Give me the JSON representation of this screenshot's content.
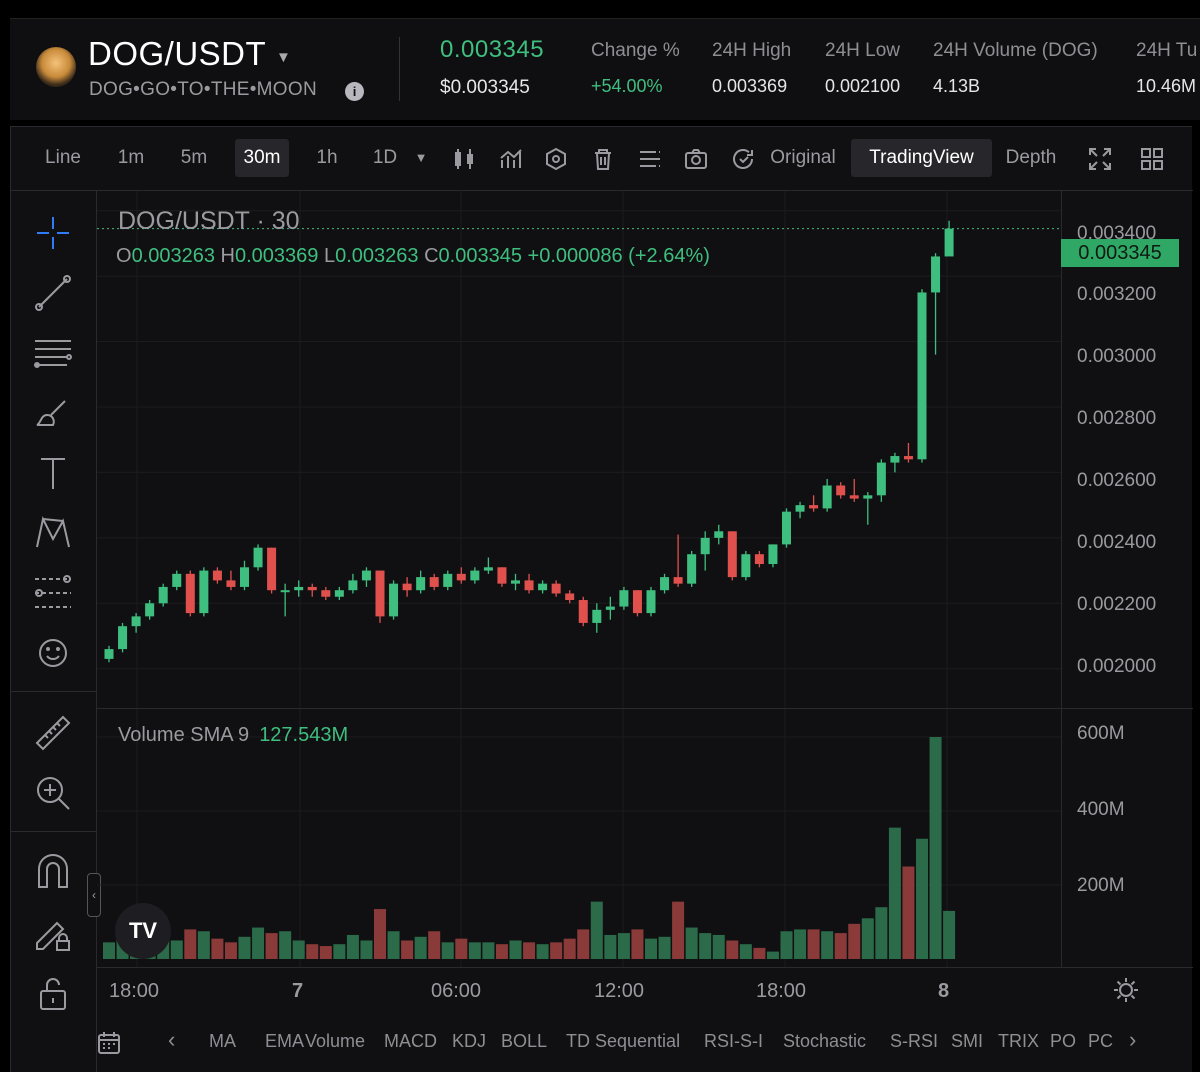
{
  "header": {
    "pair": "DOG/USDT",
    "subtitle": "DOG•GO•TO•THE•MOON",
    "price": "0.003345",
    "price_usd": "$0.003345",
    "stats": [
      {
        "label": "Change %",
        "value": "+54.00%",
        "positive": true
      },
      {
        "label": "24H High",
        "value": "0.003369"
      },
      {
        "label": "24H Low",
        "value": "0.002100"
      },
      {
        "label": "24H Volume (DOG)",
        "value": "4.13B"
      },
      {
        "label": "24H Tu",
        "value": "10.46M"
      }
    ]
  },
  "toolbar": {
    "intervals": [
      "Line",
      "1m",
      "5m",
      "30m",
      "1h",
      "1D"
    ],
    "active_interval": "30m",
    "views": [
      "Original",
      "TradingView",
      "Depth"
    ],
    "active_view": "TradingView"
  },
  "chart": {
    "pair_label": "DOG/USDT · 30",
    "ohlc": {
      "o": "0.003263",
      "h": "0.003369",
      "l": "0.003263",
      "c": "0.003345",
      "chg": "+0.000086 (+2.64%)"
    },
    "o_key": "O",
    "h_key": "H",
    "l_key": "L",
    "c_key": "C",
    "current_price_tag": "0.003345",
    "volume_label": "Volume SMA 9",
    "volume_value": "127.543M",
    "price_axis": [
      "0.003400",
      "0.003200",
      "0.003000",
      "0.002800",
      "0.002600",
      "0.002400",
      "0.002200",
      "0.002000"
    ],
    "volume_axis": [
      "600M",
      "400M",
      "200M"
    ],
    "time_axis": [
      {
        "label": "18:00",
        "bold": false
      },
      {
        "label": "7",
        "bold": true
      },
      {
        "label": "06:00",
        "bold": false
      },
      {
        "label": "12:00",
        "bold": false
      },
      {
        "label": "18:00",
        "bold": false
      },
      {
        "label": "8",
        "bold": true
      }
    ],
    "up_color": "#3fbf7f",
    "down_color": "#e0514e"
  },
  "indicators": [
    "MA",
    "EMA",
    "Volume",
    "MACD",
    "KDJ",
    "BOLL",
    "TD Sequential",
    "RSI-S-I",
    "Stochastic",
    "S-RSI",
    "SMI",
    "TRIX",
    "PO",
    "PC"
  ],
  "chart_data": {
    "type": "candlestick",
    "pair": "DOG/USDT",
    "interval": "30",
    "price_range": [
      0.00188,
      0.00346
    ],
    "volume_range": [
      0,
      600000000
    ],
    "candles": [
      {
        "o": 0.00203,
        "h": 0.00207,
        "l": 0.00202,
        "c": 0.00206,
        "v": 45
      },
      {
        "o": 0.00206,
        "h": 0.00214,
        "l": 0.00205,
        "c": 0.00213,
        "v": 70
      },
      {
        "o": 0.00213,
        "h": 0.00217,
        "l": 0.00211,
        "c": 0.00216,
        "v": 40
      },
      {
        "o": 0.00216,
        "h": 0.00221,
        "l": 0.00215,
        "c": 0.0022,
        "v": 55
      },
      {
        "o": 0.0022,
        "h": 0.00226,
        "l": 0.00219,
        "c": 0.00225,
        "v": 65
      },
      {
        "o": 0.00225,
        "h": 0.0023,
        "l": 0.00224,
        "c": 0.00229,
        "v": 50
      },
      {
        "o": 0.00229,
        "h": 0.0023,
        "l": 0.00216,
        "c": 0.00217,
        "v": 80
      },
      {
        "o": 0.00217,
        "h": 0.00231,
        "l": 0.00216,
        "c": 0.0023,
        "v": 75
      },
      {
        "o": 0.0023,
        "h": 0.00231,
        "l": 0.00226,
        "c": 0.00227,
        "v": 55
      },
      {
        "o": 0.00227,
        "h": 0.0023,
        "l": 0.00224,
        "c": 0.00225,
        "v": 45
      },
      {
        "o": 0.00225,
        "h": 0.00233,
        "l": 0.00224,
        "c": 0.00231,
        "v": 60
      },
      {
        "o": 0.00231,
        "h": 0.00238,
        "l": 0.0023,
        "c": 0.00237,
        "v": 85
      },
      {
        "o": 0.00237,
        "h": 0.00237,
        "l": 0.00223,
        "c": 0.00224,
        "v": 70
      },
      {
        "o": 0.00224,
        "h": 0.00226,
        "l": 0.00216,
        "c": 0.00224,
        "v": 75
      },
      {
        "o": 0.00224,
        "h": 0.00227,
        "l": 0.00222,
        "c": 0.00225,
        "v": 50
      },
      {
        "o": 0.00225,
        "h": 0.00226,
        "l": 0.00222,
        "c": 0.00224,
        "v": 40
      },
      {
        "o": 0.00224,
        "h": 0.00225,
        "l": 0.00221,
        "c": 0.00222,
        "v": 35
      },
      {
        "o": 0.00222,
        "h": 0.00225,
        "l": 0.00221,
        "c": 0.00224,
        "v": 40
      },
      {
        "o": 0.00224,
        "h": 0.00229,
        "l": 0.00223,
        "c": 0.00227,
        "v": 65
      },
      {
        "o": 0.00227,
        "h": 0.00231,
        "l": 0.00225,
        "c": 0.0023,
        "v": 50
      },
      {
        "o": 0.0023,
        "h": 0.0023,
        "l": 0.00214,
        "c": 0.00216,
        "v": 135
      },
      {
        "o": 0.00216,
        "h": 0.00227,
        "l": 0.00215,
        "c": 0.00226,
        "v": 75
      },
      {
        "o": 0.00226,
        "h": 0.00228,
        "l": 0.00222,
        "c": 0.00224,
        "v": 50
      },
      {
        "o": 0.00224,
        "h": 0.0023,
        "l": 0.00223,
        "c": 0.00228,
        "v": 60
      },
      {
        "o": 0.00228,
        "h": 0.00229,
        "l": 0.00224,
        "c": 0.00225,
        "v": 75
      },
      {
        "o": 0.00225,
        "h": 0.0023,
        "l": 0.00224,
        "c": 0.00229,
        "v": 45
      },
      {
        "o": 0.00229,
        "h": 0.00231,
        "l": 0.00226,
        "c": 0.00227,
        "v": 55
      },
      {
        "o": 0.00227,
        "h": 0.00231,
        "l": 0.00226,
        "c": 0.0023,
        "v": 45
      },
      {
        "o": 0.0023,
        "h": 0.00234,
        "l": 0.00229,
        "c": 0.00231,
        "v": 45
      },
      {
        "o": 0.00231,
        "h": 0.00231,
        "l": 0.00225,
        "c": 0.00226,
        "v": 40
      },
      {
        "o": 0.00226,
        "h": 0.00229,
        "l": 0.00224,
        "c": 0.00227,
        "v": 50
      },
      {
        "o": 0.00227,
        "h": 0.00229,
        "l": 0.00223,
        "c": 0.00224,
        "v": 45
      },
      {
        "o": 0.00224,
        "h": 0.00227,
        "l": 0.00223,
        "c": 0.00226,
        "v": 40
      },
      {
        "o": 0.00226,
        "h": 0.00227,
        "l": 0.00222,
        "c": 0.00223,
        "v": 45
      },
      {
        "o": 0.00223,
        "h": 0.00224,
        "l": 0.0022,
        "c": 0.00221,
        "v": 55
      },
      {
        "o": 0.00221,
        "h": 0.00222,
        "l": 0.00213,
        "c": 0.00214,
        "v": 80
      },
      {
        "o": 0.00214,
        "h": 0.0022,
        "l": 0.00211,
        "c": 0.00218,
        "v": 155
      },
      {
        "o": 0.00218,
        "h": 0.00222,
        "l": 0.00215,
        "c": 0.00219,
        "v": 65
      },
      {
        "o": 0.00219,
        "h": 0.00225,
        "l": 0.00218,
        "c": 0.00224,
        "v": 70
      },
      {
        "o": 0.00224,
        "h": 0.00224,
        "l": 0.00216,
        "c": 0.00217,
        "v": 80
      },
      {
        "o": 0.00217,
        "h": 0.00225,
        "l": 0.00216,
        "c": 0.00224,
        "v": 55
      },
      {
        "o": 0.00224,
        "h": 0.00229,
        "l": 0.00223,
        "c": 0.00228,
        "v": 60
      },
      {
        "o": 0.00228,
        "h": 0.00241,
        "l": 0.00225,
        "c": 0.00226,
        "v": 155
      },
      {
        "o": 0.00226,
        "h": 0.00236,
        "l": 0.00225,
        "c": 0.00235,
        "v": 85
      },
      {
        "o": 0.00235,
        "h": 0.00242,
        "l": 0.0023,
        "c": 0.0024,
        "v": 70
      },
      {
        "o": 0.0024,
        "h": 0.00244,
        "l": 0.00238,
        "c": 0.00242,
        "v": 65
      },
      {
        "o": 0.00242,
        "h": 0.00242,
        "l": 0.00227,
        "c": 0.00228,
        "v": 50
      },
      {
        "o": 0.00228,
        "h": 0.00236,
        "l": 0.00227,
        "c": 0.00235,
        "v": 40
      },
      {
        "o": 0.00235,
        "h": 0.00236,
        "l": 0.00231,
        "c": 0.00232,
        "v": 30
      },
      {
        "o": 0.00232,
        "h": 0.00238,
        "l": 0.00231,
        "c": 0.00238,
        "v": 20
      },
      {
        "o": 0.00238,
        "h": 0.00249,
        "l": 0.00237,
        "c": 0.00248,
        "v": 75
      },
      {
        "o": 0.00248,
        "h": 0.00251,
        "l": 0.00246,
        "c": 0.0025,
        "v": 80
      },
      {
        "o": 0.0025,
        "h": 0.00253,
        "l": 0.00248,
        "c": 0.00249,
        "v": 80
      },
      {
        "o": 0.00249,
        "h": 0.00258,
        "l": 0.00248,
        "c": 0.00256,
        "v": 75
      },
      {
        "o": 0.00256,
        "h": 0.00257,
        "l": 0.00252,
        "c": 0.00253,
        "v": 70
      },
      {
        "o": 0.00253,
        "h": 0.00258,
        "l": 0.00251,
        "c": 0.00252,
        "v": 95
      },
      {
        "o": 0.00252,
        "h": 0.00254,
        "l": 0.00244,
        "c": 0.00253,
        "v": 110
      },
      {
        "o": 0.00253,
        "h": 0.00264,
        "l": 0.00251,
        "c": 0.00263,
        "v": 140
      },
      {
        "o": 0.00263,
        "h": 0.00266,
        "l": 0.0026,
        "c": 0.00265,
        "v": 355
      },
      {
        "o": 0.00265,
        "h": 0.00269,
        "l": 0.00263,
        "c": 0.00264,
        "v": 250
      },
      {
        "o": 0.00264,
        "h": 0.00316,
        "l": 0.00263,
        "c": 0.00315,
        "v": 325
      },
      {
        "o": 0.00315,
        "h": 0.00327,
        "l": 0.00296,
        "c": 0.00326,
        "v": 600
      },
      {
        "o": 0.00326,
        "h": 0.003369,
        "l": 0.003263,
        "c": 0.003345,
        "v": 130
      }
    ]
  }
}
